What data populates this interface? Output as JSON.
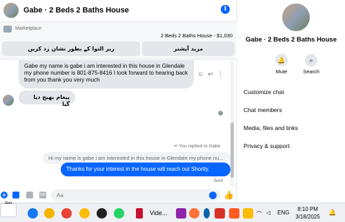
{
  "chat": {
    "title": "Gabe · 2 Beds 2 Baths House",
    "info_icon": "i",
    "marketplace": {
      "label": "Marketplace",
      "listing": "2 Beds 2 Baths House - $1,030",
      "button_left": "زیر التوا کے بطور نشان زد کریں",
      "button_right": "مزید آپشنز"
    },
    "messages": [
      {
        "direction": "in",
        "text": "Gabe my name is gabe i am interested in this house in Glendale my phone number is 801-875-8416 I look forward to hearing back from you thank you very much"
      },
      {
        "direction": "in",
        "text": "پیغام بھیج دیا گیا"
      }
    ],
    "reply_note": "You replied to Gabe",
    "quoted": "Hi my name is gabe i am interested in this house in Glendale my phone nu...",
    "my_message": "Thanks for your interest in the house will reach out Shortly.",
    "status": "Sent",
    "composer": {
      "placeholder": "Aa",
      "plus": "+",
      "gif": "GIF",
      "like": "👍"
    }
  },
  "details": {
    "title": "Gabe · 2 Beds 2 Baths House",
    "actions": [
      {
        "label": "Mute",
        "icon": "bell-icon",
        "glyph": "🔔"
      },
      {
        "label": "Search",
        "icon": "search-icon",
        "glyph": "⌕"
      }
    ],
    "items": [
      "Customize chat",
      "Chat members",
      "Media, files and links",
      "Privacy & support"
    ]
  },
  "taskbar": {
    "start_label": "Start",
    "video_label": "Vide...",
    "language": "ENG",
    "time": "8:10 PM",
    "date": "3/18/2025",
    "icons": [
      "start",
      "facebook-icon",
      "paint-icon",
      "chrome-icon",
      "chrome-icon",
      "chatgpt-icon",
      "whatsapp-icon",
      "nba-icon",
      "video-icon",
      "app-icon",
      "firefox-icon",
      "bluetooth-icon",
      "app-icon",
      "app-icon"
    ]
  }
}
